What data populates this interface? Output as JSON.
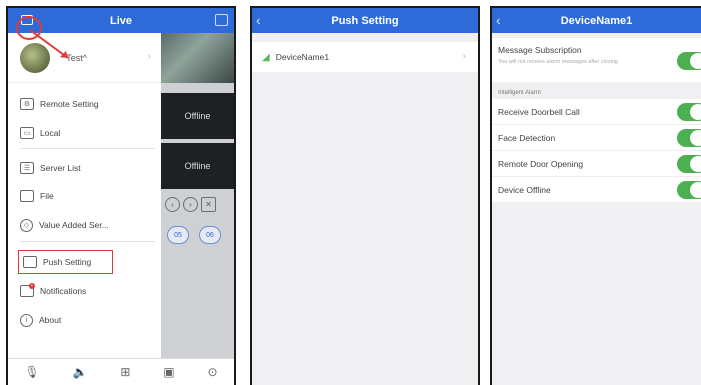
{
  "panel1": {
    "title": "Live",
    "profile_name": "^Test^",
    "menu": {
      "remote_setting": "Remote Setting",
      "local": "Local",
      "server_list": "Server List",
      "file": "File",
      "value_added": "Value Added Ser...",
      "push_setting": "Push Setting",
      "notifications": "Notifications",
      "about": "About"
    },
    "offline_1": "Offline",
    "offline_2": "Offline",
    "channel_1": "05",
    "channel_2": "06"
  },
  "panel2": {
    "title": "Push Setting",
    "device_name": "DeviceName1"
  },
  "panel3": {
    "title": "DeviceName1",
    "subscription_title": "Message Subscription",
    "subscription_desc": "You will not receive alarm messages after closing",
    "section_label": "Intelligent Alarm",
    "alarms": [
      {
        "label": "Receive Doorbell Call",
        "on": true
      },
      {
        "label": "Face Detection",
        "on": true
      },
      {
        "label": "Remote Door Opening",
        "on": true
      },
      {
        "label": "Device Offline",
        "on": true
      }
    ]
  },
  "colors": {
    "topbar": "#2f6bd8",
    "toggle_on": "#4caf50",
    "annotation": "#e03a3a"
  }
}
